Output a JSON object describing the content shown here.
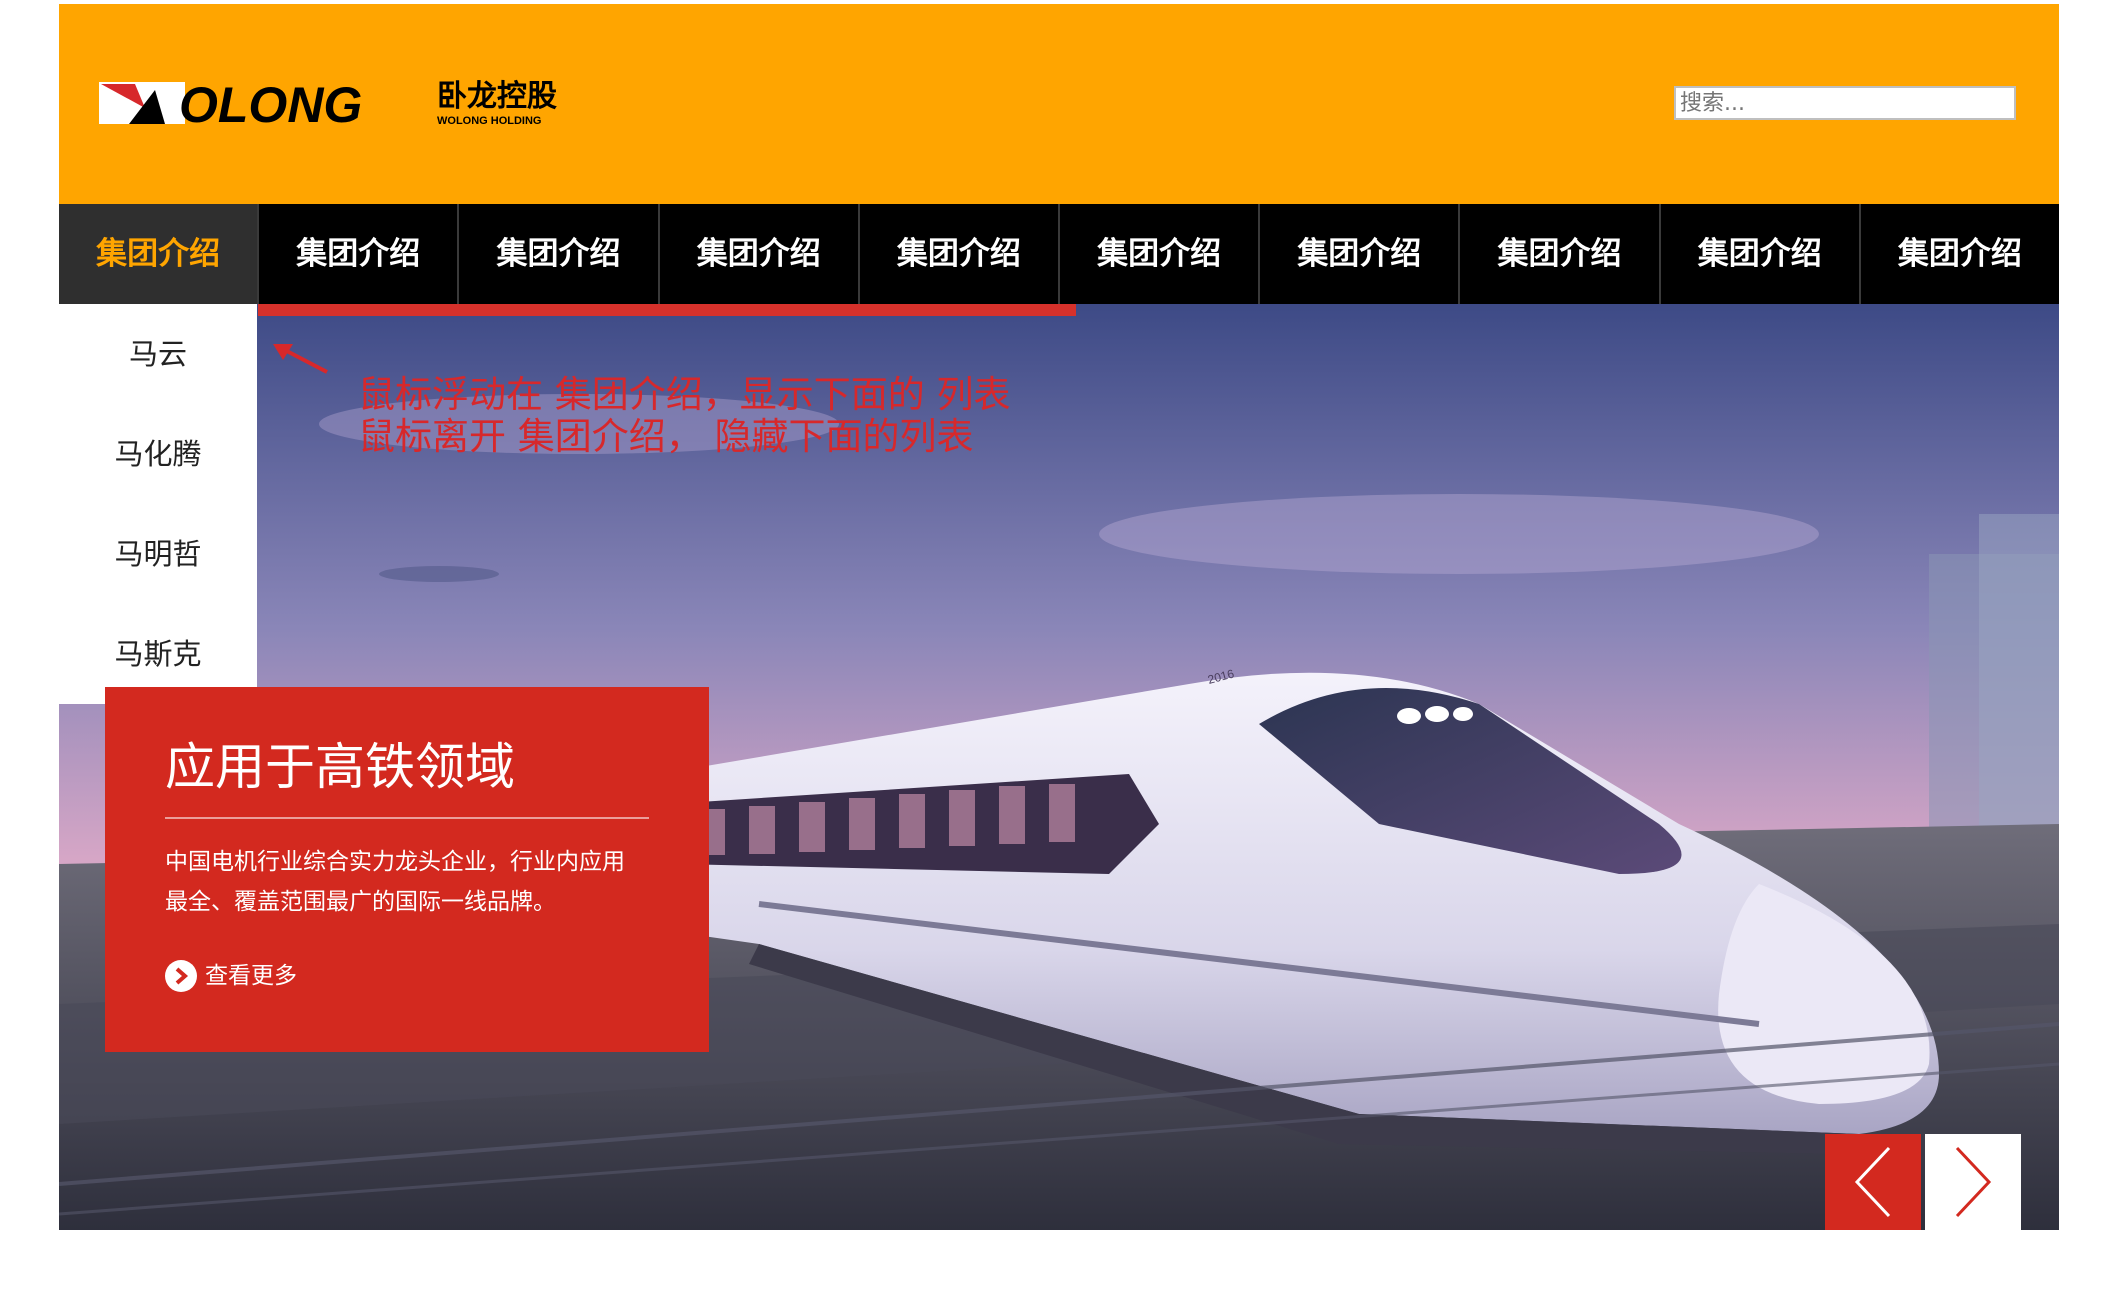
{
  "header": {
    "logo": {
      "wordmark": "OLONG",
      "chinese": "卧龙控股",
      "english": "WOLONG HOLDING"
    },
    "search_placeholder": "搜索..."
  },
  "nav": {
    "items": [
      {
        "label": "集团介绍",
        "active": true
      },
      {
        "label": "集团介绍"
      },
      {
        "label": "集团介绍"
      },
      {
        "label": "集团介绍"
      },
      {
        "label": "集团介绍"
      },
      {
        "label": "集团介绍"
      },
      {
        "label": "集团介绍"
      },
      {
        "label": "集团介绍"
      },
      {
        "label": "集团介绍"
      },
      {
        "label": "集团介绍"
      }
    ]
  },
  "dropdown": {
    "items": [
      "马云",
      "马化腾",
      "马明哲",
      "马斯克"
    ]
  },
  "annotation": {
    "line1": "鼠标浮动在 集团介绍，显示下面的 列表",
    "line2": "鼠标离开 集团介绍， 隐藏下面的列表"
  },
  "slide": {
    "title": "应用于高铁领域",
    "desc_line1": "中国电机行业综合实力龙头企业，行业内应用",
    "desc_line2": "最全、覆盖范围最广的国际一线品牌。",
    "more_label": "查看更多",
    "train_badge": "2016"
  },
  "colors": {
    "header_bg": "#ffa500",
    "nav_bg": "#000000",
    "nav_active_text": "#ffa500",
    "accent_red": "#d3291f",
    "annotation_text": "#d7282b"
  },
  "icons": {
    "arrow_icon": "annotation-arrow-icon",
    "more_icon": "chevron-right-circle-icon",
    "prev_icon": "chevron-left-icon",
    "next_icon": "chevron-right-icon"
  }
}
